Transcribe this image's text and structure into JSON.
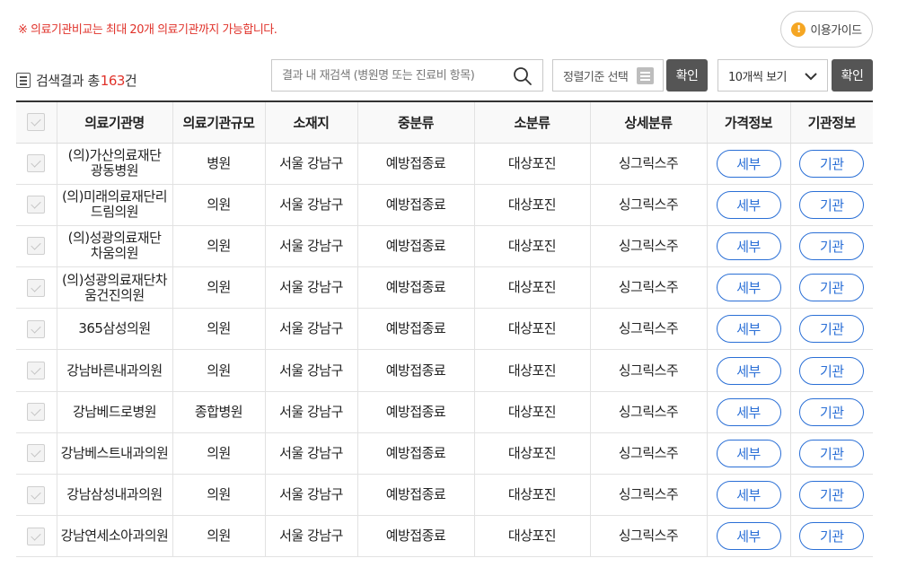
{
  "notice": "※ 의료기관비교는 최대 20개 의료기관까지 가능합니다.",
  "guide": {
    "icon_glyph": "!",
    "label": "이용가이드"
  },
  "result": {
    "prefix": "검색결과 총",
    "count": "163",
    "suffix": "건"
  },
  "search": {
    "placeholder": "결과 내 재검색 (병원명 또는 진료비 항목)",
    "value": ""
  },
  "sort": {
    "label": "정렬기준 선택"
  },
  "confirm_label": "확인",
  "per_page": {
    "selected": "10개씩 보기"
  },
  "colors": {
    "accent_blue": "#2a6fd6",
    "notice_red": "#e0322a",
    "dark_button": "#555555"
  },
  "table": {
    "headers": [
      "",
      "의료기관명",
      "의료기관규모",
      "소재지",
      "중분류",
      "소분류",
      "상세분류",
      "가격정보",
      "기관정보"
    ],
    "detail_label": "세부",
    "org_label": "기관",
    "rows": [
      {
        "name": "(의)가산의료재단 광동병원",
        "size": "병원",
        "location": "서울 강남구",
        "mid": "예방접종료",
        "small": "대상포진",
        "detail": "싱그릭스주"
      },
      {
        "name": "(의)미래의료재단리드림의원",
        "size": "의원",
        "location": "서울 강남구",
        "mid": "예방접종료",
        "small": "대상포진",
        "detail": "싱그릭스주"
      },
      {
        "name": "(의)성광의료재단 차움의원",
        "size": "의원",
        "location": "서울 강남구",
        "mid": "예방접종료",
        "small": "대상포진",
        "detail": "싱그릭스주"
      },
      {
        "name": "(의)성광의료재단차움건진의원",
        "size": "의원",
        "location": "서울 강남구",
        "mid": "예방접종료",
        "small": "대상포진",
        "detail": "싱그릭스주"
      },
      {
        "name": "365삼성의원",
        "size": "의원",
        "location": "서울 강남구",
        "mid": "예방접종료",
        "small": "대상포진",
        "detail": "싱그릭스주"
      },
      {
        "name": "강남바른내과의원",
        "size": "의원",
        "location": "서울 강남구",
        "mid": "예방접종료",
        "small": "대상포진",
        "detail": "싱그릭스주"
      },
      {
        "name": "강남베드로병원",
        "size": "종합병원",
        "location": "서울 강남구",
        "mid": "예방접종료",
        "small": "대상포진",
        "detail": "싱그릭스주"
      },
      {
        "name": "강남베스트내과의원",
        "size": "의원",
        "location": "서울 강남구",
        "mid": "예방접종료",
        "small": "대상포진",
        "detail": "싱그릭스주"
      },
      {
        "name": "강남삼성내과의원",
        "size": "의원",
        "location": "서울 강남구",
        "mid": "예방접종료",
        "small": "대상포진",
        "detail": "싱그릭스주"
      },
      {
        "name": "강남연세소아과의원",
        "size": "의원",
        "location": "서울 강남구",
        "mid": "예방접종료",
        "small": "대상포진",
        "detail": "싱그릭스주"
      }
    ]
  }
}
